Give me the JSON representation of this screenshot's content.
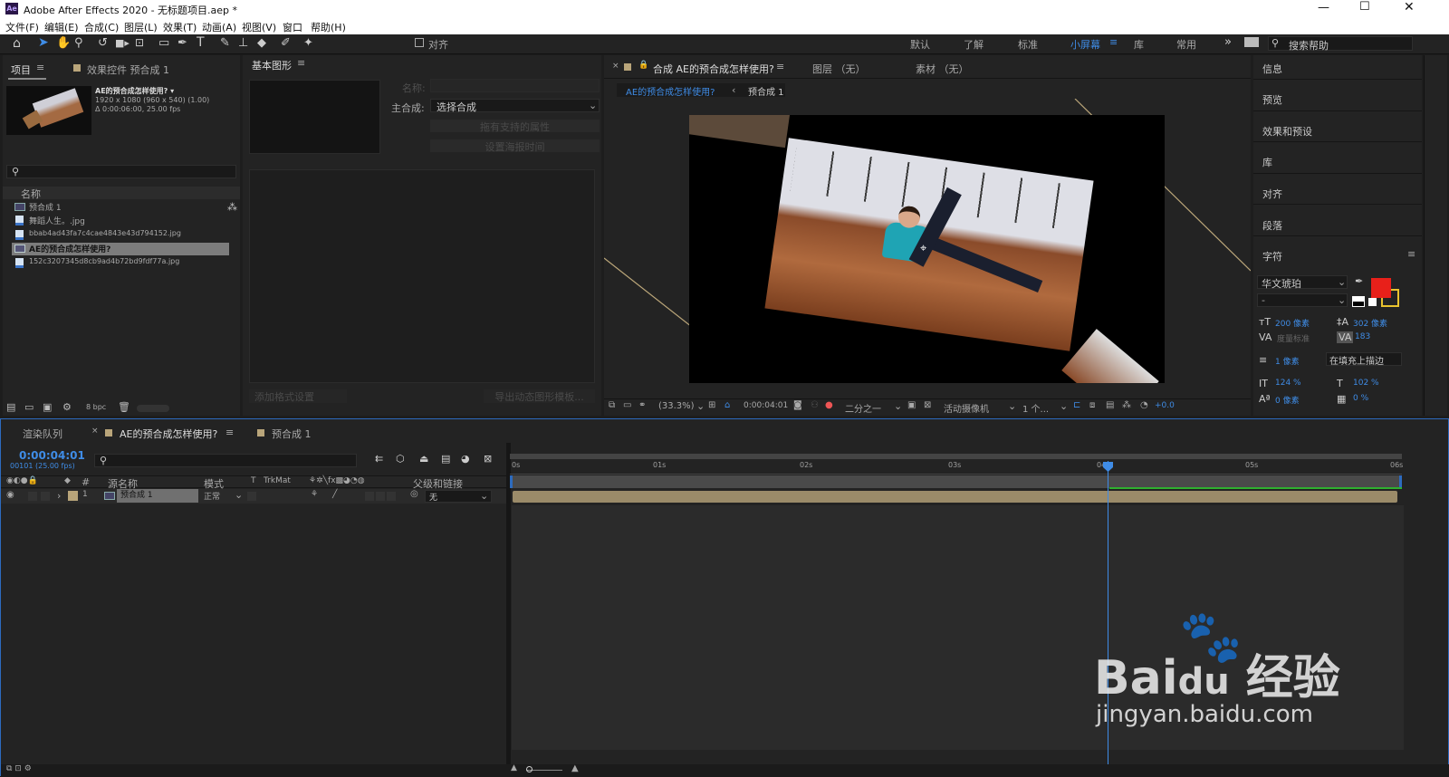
{
  "app": {
    "title": "Adobe After Effects 2020 - 无标题项目.aep *",
    "logo": "Ae"
  },
  "menu": [
    "文件(F)",
    "编辑(E)",
    "合成(C)",
    "图层(L)",
    "效果(T)",
    "动画(A)",
    "视图(V)",
    "窗口",
    "帮助(H)"
  ],
  "toolbar": {
    "align_label": "对齐",
    "workspaces": [
      "默认",
      "了解",
      "标准",
      "小屏幕",
      "库",
      "常用"
    ],
    "active_workspace": "小屏幕",
    "search_placeholder": "搜索帮助"
  },
  "project": {
    "tab_project": "项目",
    "tab_effects": "效果控件 预合成 1",
    "comp_name": "AE的预合成怎样使用? ▾",
    "comp_info1": "1920 x 1080  (960 x 540) (1.00)",
    "comp_info2": "Δ 0:00:06:00, 25.00 fps",
    "col_name": "名称",
    "items": [
      {
        "name": "预合成 1",
        "type": "comp"
      },
      {
        "name": "舞蹈人生。.jpg",
        "type": "image"
      },
      {
        "name": "bbab4ad43fa7c4cae4843e43d794152.jpg",
        "type": "image"
      },
      {
        "name": "AE的预合成怎样使用?",
        "type": "comp",
        "selected": true
      },
      {
        "name": "152c3207345d8cb9ad4b72bd9fdf77a.jpg",
        "type": "image"
      }
    ],
    "bpc": "8 bpc"
  },
  "essential": {
    "title": "基本图形",
    "name_label": "名称:",
    "master_label": "主合成:",
    "master_value": "选择合成",
    "btn1": "拖有支持的属性",
    "btn2": "设置海报时间",
    "add_format": "添加格式设置",
    "export": "导出动态图形模板..."
  },
  "comp": {
    "tab_comp": "合成 AE的预合成怎样使用?",
    "tab_layer": "图层 （无）",
    "tab_footage": "素材 （无）",
    "crumb1": "AE的预合成怎样使用?",
    "crumb2": "预合成 1",
    "zoom": "(33.3%)",
    "timecode": "0:00:04:01",
    "resolution": "二分之一",
    "camera": "活动摄像机",
    "views": "1 个...",
    "exposure": "+0.0"
  },
  "right": {
    "items": [
      "信息",
      "预览",
      "效果和预设",
      "库",
      "对齐",
      "段落"
    ],
    "char_title": "字符",
    "font": "华文琥珀",
    "style": "-",
    "size": "200 像素",
    "leading": "302 像素",
    "kerning_label": "度量标准",
    "tracking": "183",
    "stroke": "1 像素",
    "stroke_mode": "在填充上描边",
    "vscale": "124 %",
    "hscale": "102 %",
    "baseline": "0 像素",
    "tsume": "0 %",
    "fill_color": "#e8201a",
    "stroke_color": "#e9c32e"
  },
  "timeline": {
    "tab_render": "渲染队列",
    "tab_comp": "AE的预合成怎样使用?",
    "tab_pre": "预合成 1",
    "timecode": "0:00:04:01",
    "frames": "00101 (25.00 fps)",
    "cols": {
      "num": "#",
      "src": "源名称",
      "mode": "模式",
      "t": "T",
      "trkmat": "TrkMat",
      "parent": "父级和链接"
    },
    "layer": {
      "num": "1",
      "name": "预合成 1",
      "mode": "正常",
      "parent": "无"
    },
    "ticks": [
      "0s",
      "01s",
      "02s",
      "03s",
      "04s",
      "05s",
      "06s"
    ],
    "playhead_seconds": 4.04,
    "duration_seconds": 6
  }
}
